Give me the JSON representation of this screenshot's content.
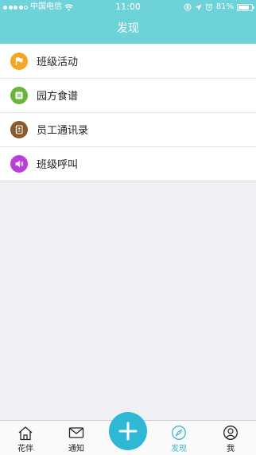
{
  "status_bar": {
    "carrier": "中国电信",
    "time": "11:00",
    "battery_percent_text": "81%",
    "battery_level": 0.81
  },
  "nav": {
    "title": "发现"
  },
  "list": {
    "items": [
      {
        "label": "班级活动",
        "icon": "flag-icon",
        "color": "#f5a623"
      },
      {
        "label": "园方食谱",
        "icon": "menu-book-icon",
        "color": "#6bb43a"
      },
      {
        "label": "员工通讯录",
        "icon": "contacts-book-icon",
        "color": "#8a5a2b"
      },
      {
        "label": "班级呼叫",
        "icon": "speaker-icon",
        "color": "#b93fd9"
      }
    ]
  },
  "tabbar": {
    "tabs": [
      {
        "label": "花伴",
        "icon": "home-icon"
      },
      {
        "label": "通知",
        "icon": "mail-icon"
      },
      {
        "label": "发现",
        "icon": "compass-icon",
        "active": true
      },
      {
        "label": "我",
        "icon": "user-icon"
      }
    ],
    "center_button": {
      "icon": "plus-icon"
    }
  },
  "colors": {
    "header": "#6ed2d9",
    "accent": "#2fb8d6",
    "active_tab": "#3db8d2"
  }
}
